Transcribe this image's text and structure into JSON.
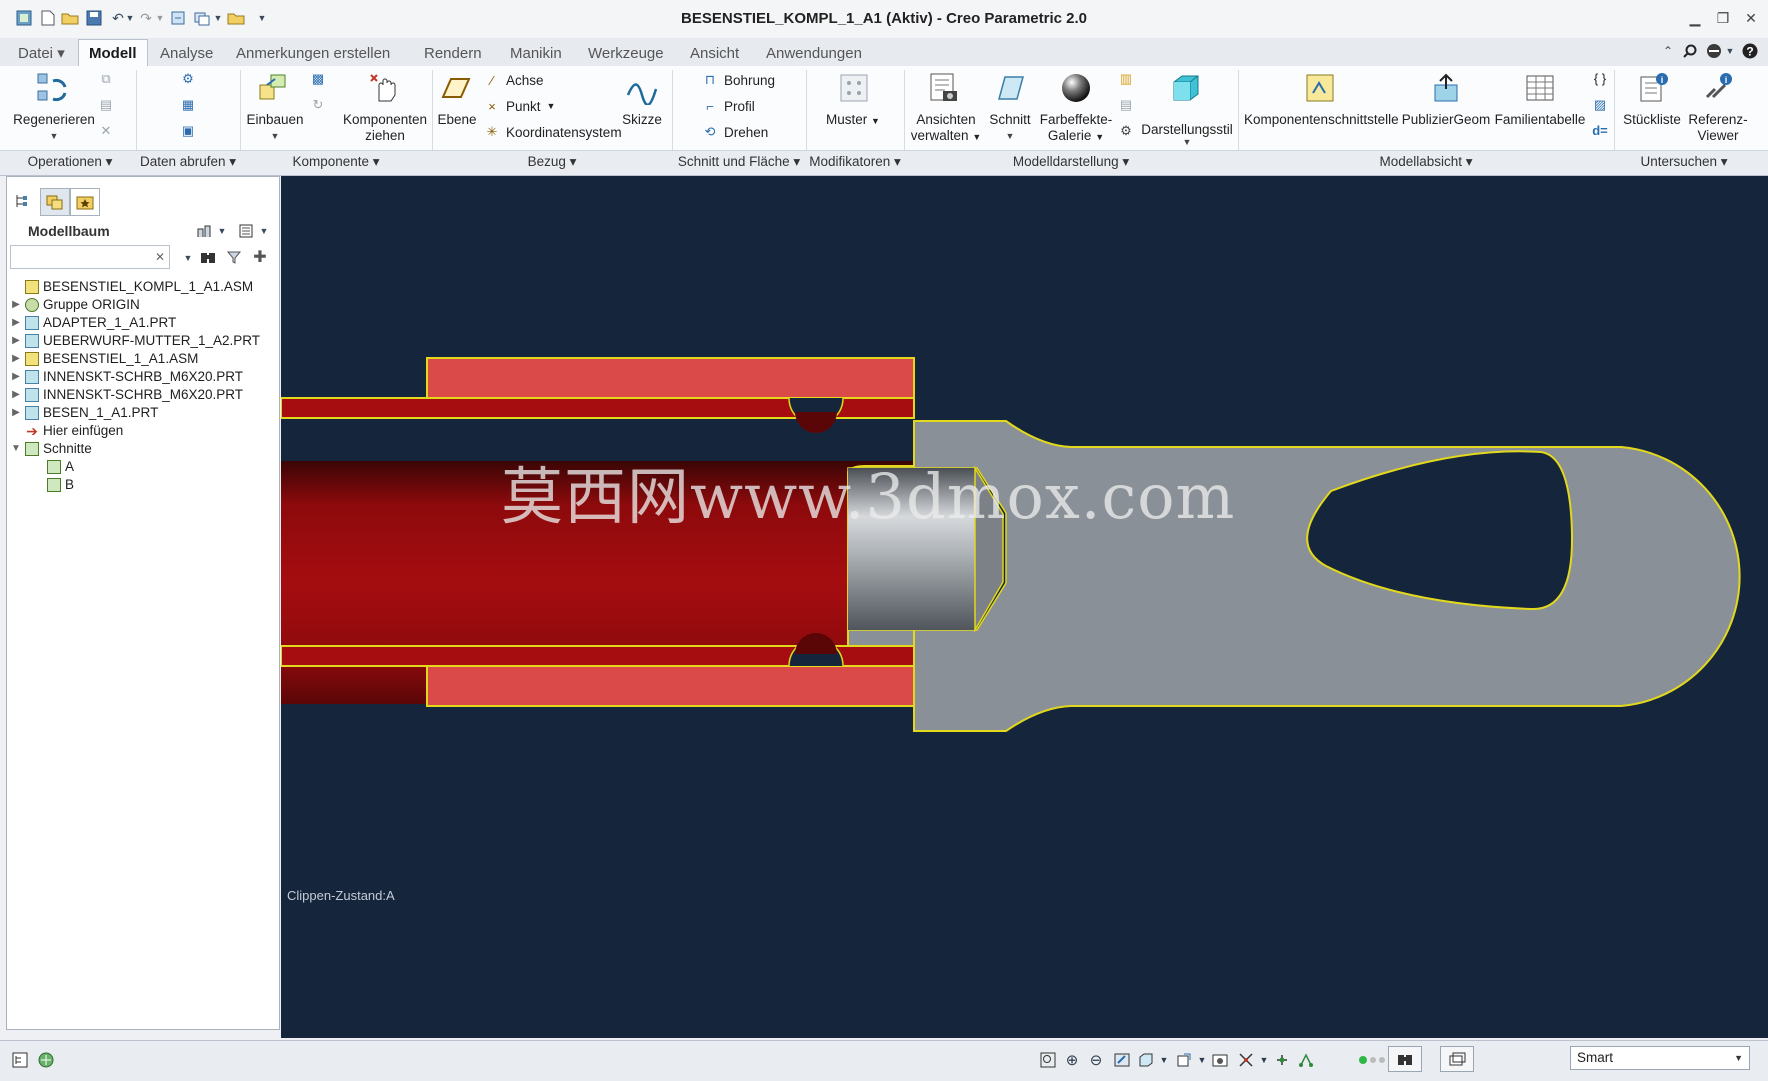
{
  "window": {
    "title": "BESENSTIEL_KOMPL_1_A1 (Aktiv) - Creo Parametric 2.0"
  },
  "tabs": [
    "Datei",
    "Modell",
    "Analyse",
    "Anmerkungen erstellen",
    "Rendern",
    "Manikin",
    "Werkzeuge",
    "Ansicht",
    "Anwendungen"
  ],
  "active_tab": "Modell",
  "ribbon": {
    "regenerieren": "Regenerieren",
    "einbauen": "Einbauen",
    "komponenten_ziehen_1": "Komponenten",
    "komponenten_ziehen_2": "ziehen",
    "ebene": "Ebene",
    "achse": "Achse",
    "punkt": "Punkt",
    "koordinatensystem": "Koordinatensystem",
    "skizze": "Skizze",
    "bohrung": "Bohrung",
    "profil": "Profil",
    "drehen": "Drehen",
    "muster": "Muster",
    "ansichten_verwalten_1": "Ansichten",
    "ansichten_verwalten_2": "verwalten",
    "schnitt": "Schnitt",
    "farbeffekte_1": "Farbeffekte-",
    "farbeffekte_2": "Galerie",
    "darstellungsstil": "Darstellungsstil",
    "komponentenschnittstelle": "Komponentenschnittstelle",
    "publiziergeom": "PublizierGeom",
    "familientabelle": "Familientabelle",
    "stueckliste": "Stückliste",
    "referenz_viewer_1": "Referenz-",
    "referenz_viewer_2": "Viewer",
    "d_eq": "d="
  },
  "groups": [
    "Operationen",
    "Daten abrufen",
    "Komponente",
    "Bezug",
    "Schnitt und Fläche",
    "Modifikatoren",
    "Modelldarstellung",
    "Modellabsicht",
    "Untersuchen"
  ],
  "modelltree": {
    "title": "Modellbaum",
    "search_placeholder": "",
    "items": [
      {
        "label": "BESENSTIEL_KOMPL_1_A1.ASM",
        "expander": "",
        "icon": "assembly-icon"
      },
      {
        "label": "Gruppe ORIGIN",
        "expander": "▶",
        "icon": "group-icon"
      },
      {
        "label": "ADAPTER_1_A1.PRT",
        "expander": "▶",
        "icon": "part-icon"
      },
      {
        "label": "UEBERWURF-MUTTER_1_A2.PRT",
        "expander": "▶",
        "icon": "part-icon"
      },
      {
        "label": "BESENSTIEL_1_A1.ASM",
        "expander": "▶",
        "icon": "assembly-icon"
      },
      {
        "label": "INNENSKT-SCHRB_M6X20.PRT",
        "expander": "▶",
        "icon": "part-icon"
      },
      {
        "label": "INNENSKT-SCHRB_M6X20.PRT",
        "expander": "▶",
        "icon": "part-icon"
      },
      {
        "label": "BESEN_1_A1.PRT",
        "expander": "▶",
        "icon": "part-icon"
      },
      {
        "label": "Hier einfügen",
        "expander": "",
        "icon": "insert-arrow-icon"
      },
      {
        "label": "Schnitte",
        "expander": "▼",
        "icon": "sections-icon"
      },
      {
        "label": "A",
        "expander": "",
        "icon": "section-icon"
      },
      {
        "label": "B",
        "expander": "",
        "icon": "section-icon"
      }
    ]
  },
  "viewport": {
    "clip_status": "Clippen-Zustand:A",
    "watermark": "莫西网www.3dmox.com"
  },
  "statusbar": {
    "filter_value": "Smart"
  },
  "colors": {
    "viewport_bg": "#15253b",
    "tube_red": "#a10d10",
    "nut_red": "#d94a48",
    "adapter_gray": "#8a9097",
    "highlight_yellow": "#e2d81c"
  }
}
